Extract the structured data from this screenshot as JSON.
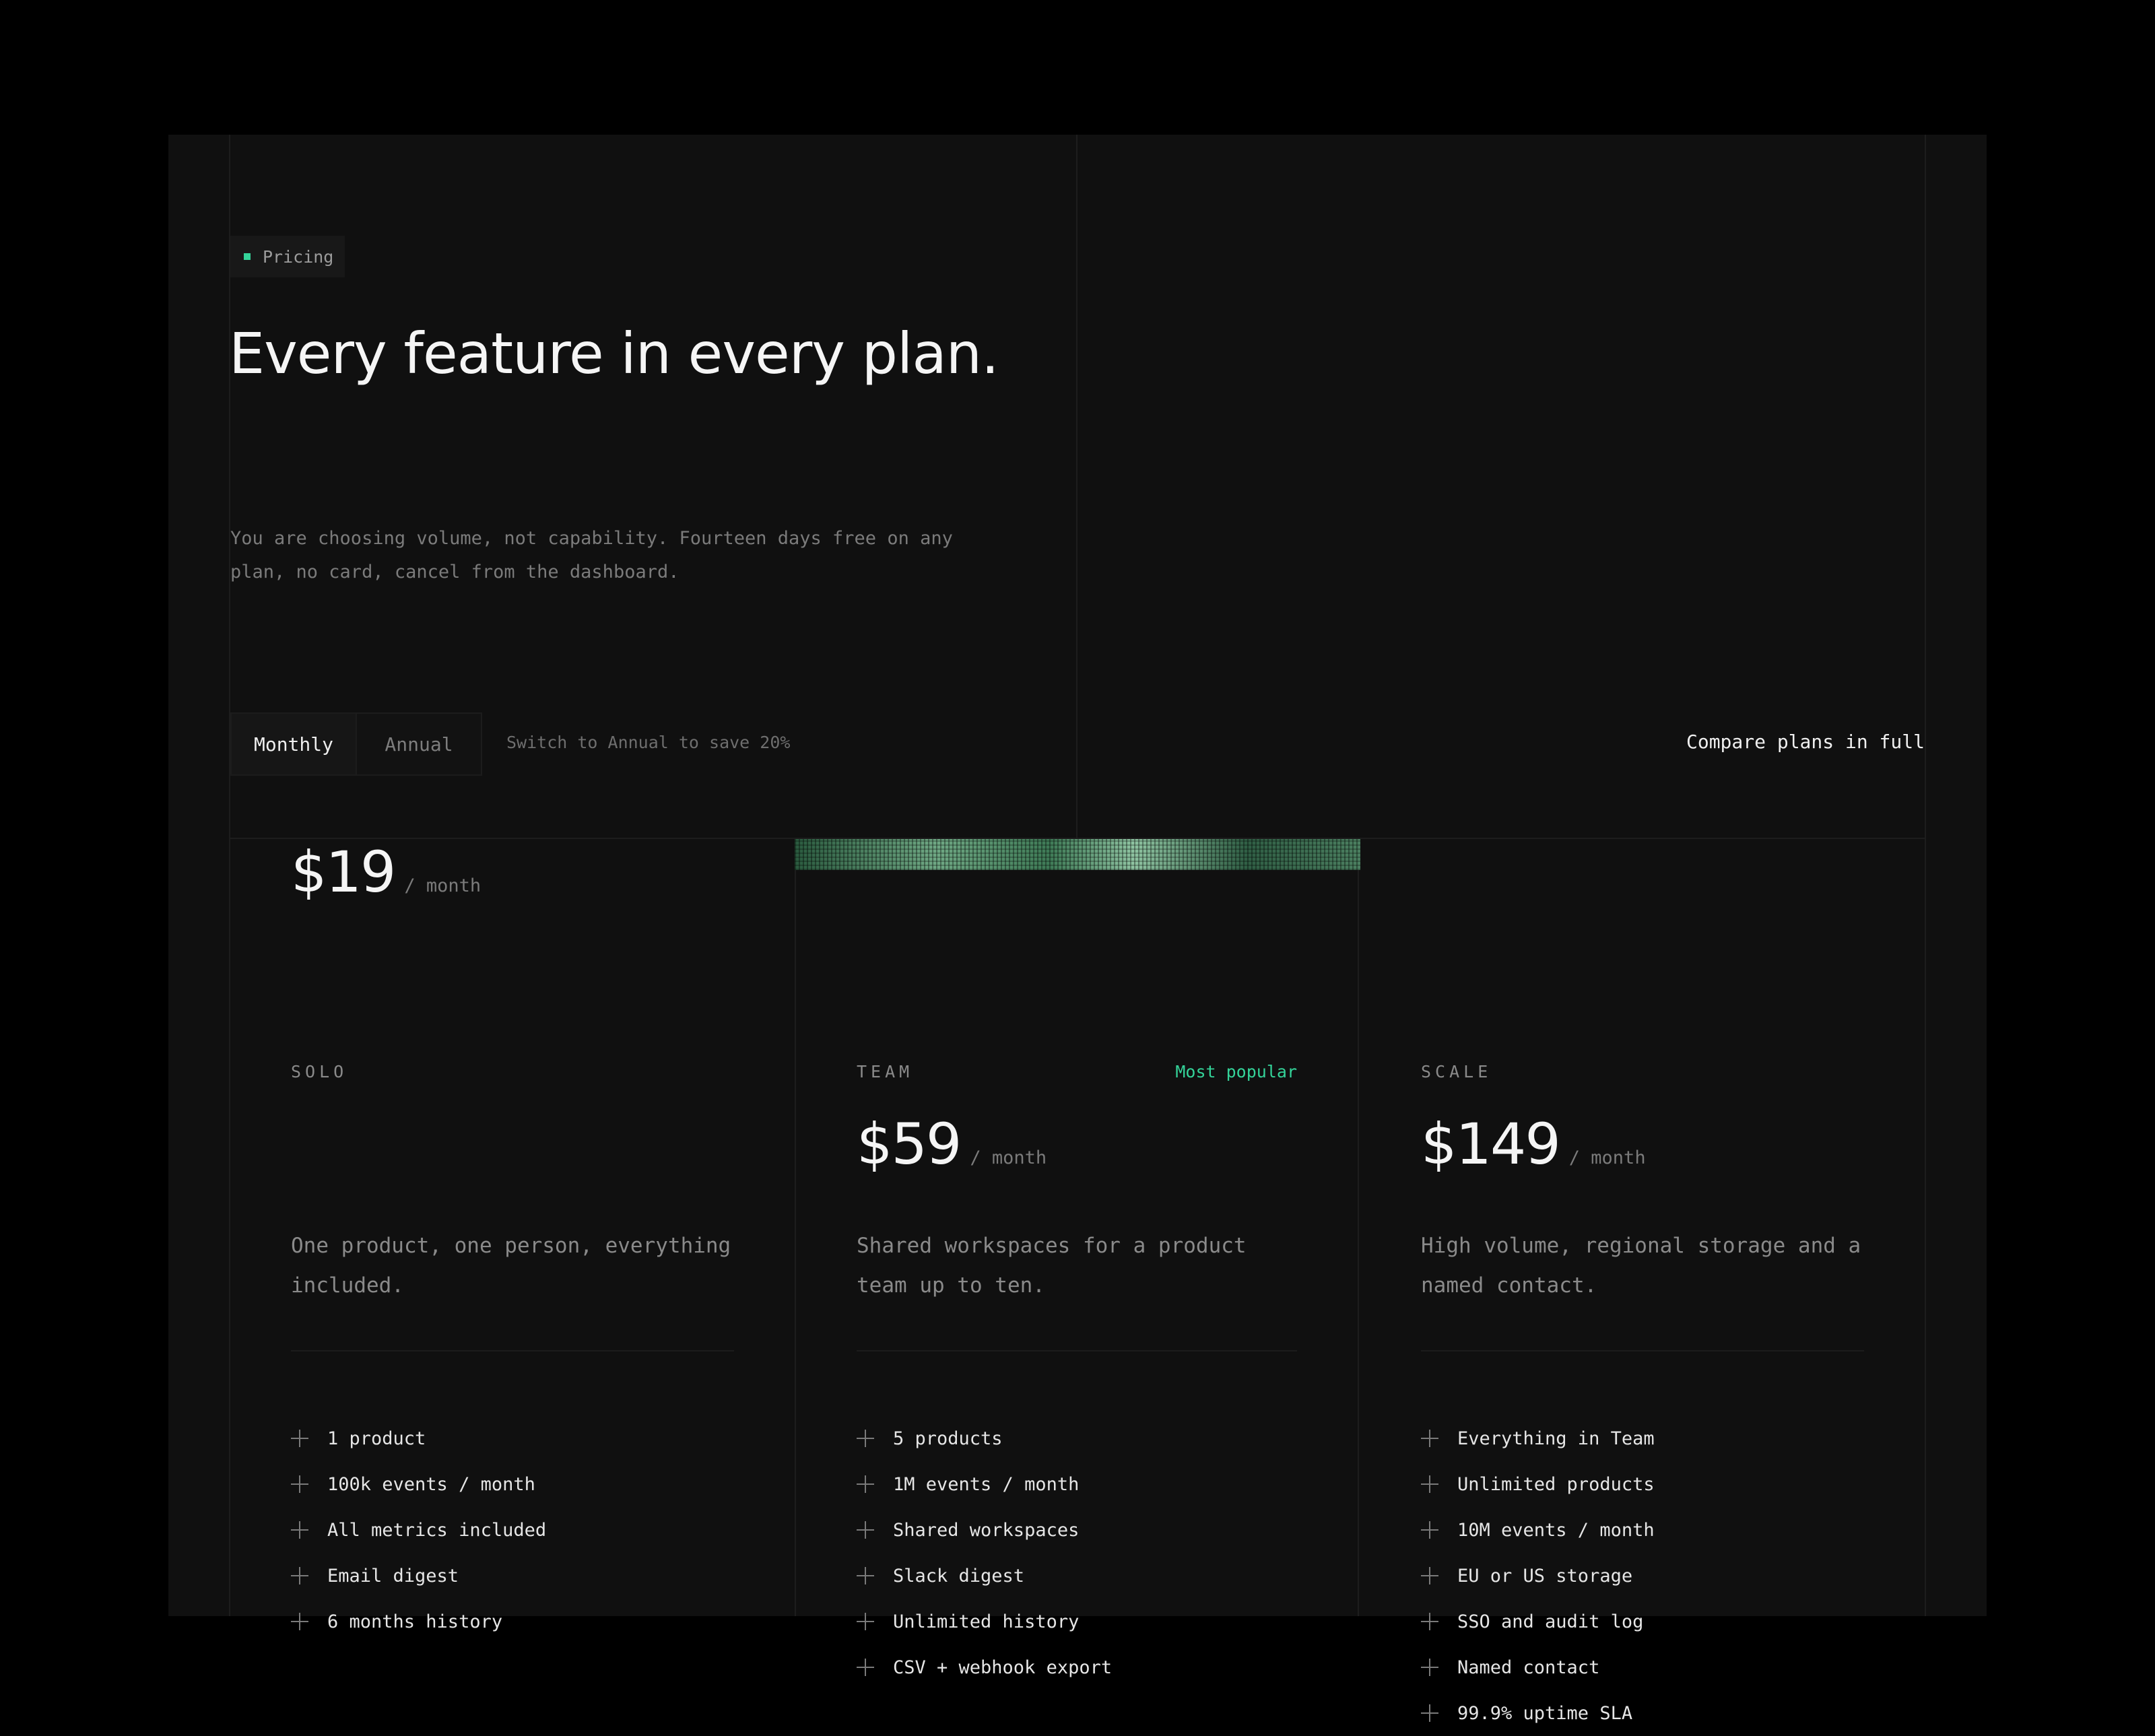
{
  "tag": {
    "label": "Pricing",
    "dot_color": "#34d399"
  },
  "headline": "Every feature in every plan.",
  "subtext": "You are choosing volume, not capability. Fourteen days free on any plan, no card, cancel from the dashboard.",
  "billing": {
    "options": [
      "Monthly",
      "Annual"
    ],
    "selected": "Monthly",
    "save_note": "Switch to Annual to save 20%"
  },
  "compare_link": "Compare plans in full",
  "plans": [
    {
      "name": "SOLO",
      "price": "$19",
      "period": "/ month",
      "description": "One product, one person, everything included.",
      "features": [
        "1 product",
        "100k events / month",
        "All metrics included",
        "Email digest",
        "6 months history"
      ]
    },
    {
      "name": "TEAM",
      "badge": "Most popular",
      "price": "$59",
      "period": "/ month",
      "description": "Shared workspaces for a product team up to ten.",
      "features": [
        "5 products",
        "1M events / month",
        "Shared workspaces",
        "Slack digest",
        "Unlimited history",
        "CSV + webhook export"
      ]
    },
    {
      "name": "SCALE",
      "price": "$149",
      "period": "/ month",
      "description": "High volume, regional storage and a named contact.",
      "features": [
        "Everything in Team",
        "Unlimited products",
        "10M events / month",
        "EU or US storage",
        "SSO and audit log",
        "Named contact",
        "99.9% uptime SLA"
      ]
    }
  ],
  "colors": {
    "accent": "#34d399",
    "background": "#101010",
    "page": "#000000"
  }
}
